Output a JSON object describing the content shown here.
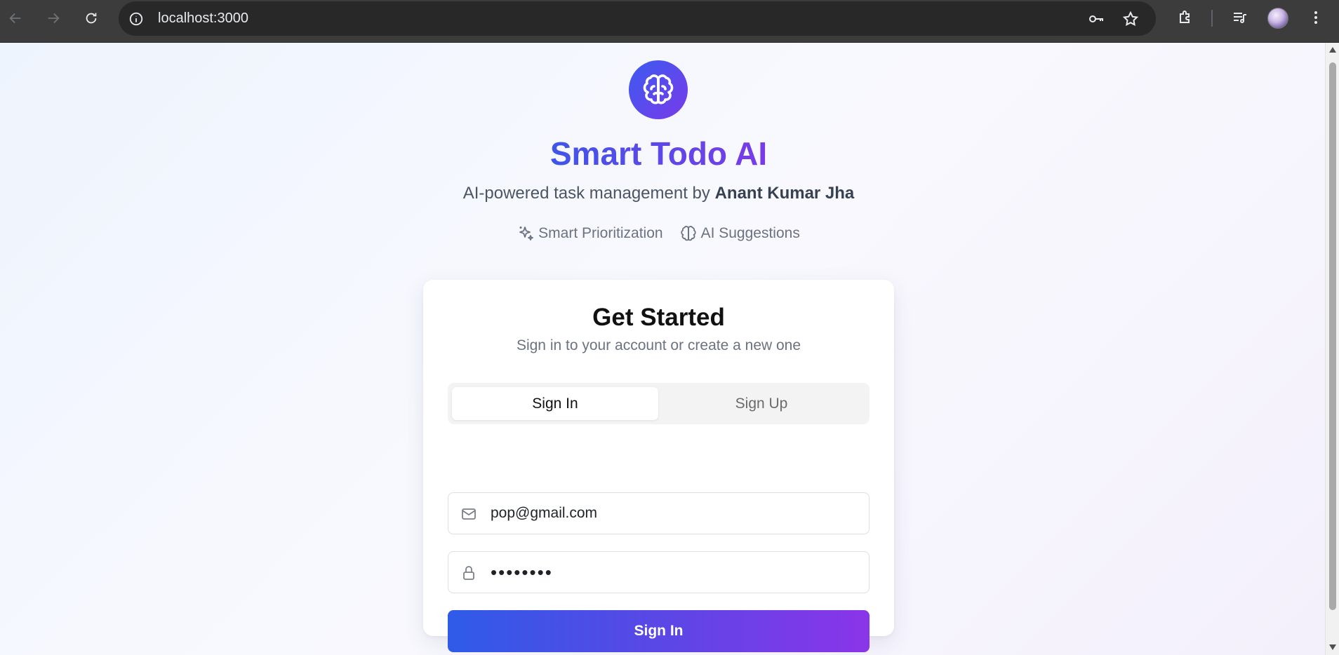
{
  "browser": {
    "url": "localhost:3000",
    "icons": {
      "back": "arrow-left-icon",
      "forward": "arrow-right-icon",
      "reload": "reload-icon",
      "site_info": "info-icon",
      "password": "key-icon",
      "bookmark": "star-icon",
      "extensions": "puzzle-icon",
      "media": "playlist-icon",
      "menu": "kebab-menu-icon"
    }
  },
  "app": {
    "title": "Smart Todo AI",
    "tagline_prefix": "AI-powered task management by ",
    "tagline_author": "Anant Kumar Jha",
    "features": [
      {
        "label": "Smart Prioritization",
        "icon": "sparkles-icon"
      },
      {
        "label": "AI Suggestions",
        "icon": "brain-icon"
      }
    ],
    "colors": {
      "accent_start": "#2f5be8",
      "accent_end": "#8a35e8"
    }
  },
  "auth_card": {
    "title": "Get Started",
    "subtitle": "Sign in to your account or create a new one",
    "tabs": [
      {
        "label": "Sign In",
        "active": true
      },
      {
        "label": "Sign Up",
        "active": false
      }
    ],
    "email": {
      "value": "pop@gmail.com",
      "icon": "mail-icon"
    },
    "password": {
      "value": "••••••••",
      "icon": "lock-icon"
    },
    "submit_label": "Sign In"
  }
}
